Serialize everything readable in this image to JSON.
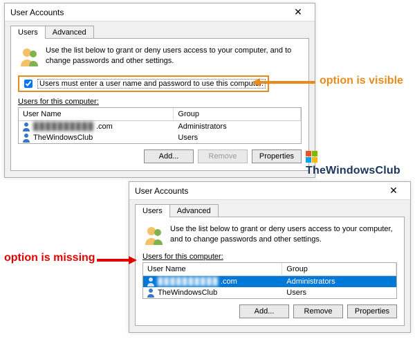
{
  "dialog1": {
    "title": "User Accounts",
    "close": "✕",
    "tabs": {
      "users": "Users",
      "advanced": "Advanced"
    },
    "intro": "Use the list below to grant or deny users access to your computer, and to change passwords and other settings.",
    "checkbox_label": "Users must enter a user name and password to use this computer.",
    "section_label": "Users for this computer:",
    "columns": {
      "name": "User Name",
      "group": "Group"
    },
    "rows": [
      {
        "name_hidden": "██████████",
        "name_suffix": ".com",
        "group": "Administrators"
      },
      {
        "name": "TheWindowsClub",
        "group": "Users"
      }
    ],
    "buttons": {
      "add": "Add...",
      "remove": "Remove",
      "props": "Properties"
    }
  },
  "dialog2": {
    "title": "User Accounts",
    "close": "✕",
    "tabs": {
      "users": "Users",
      "advanced": "Advanced"
    },
    "intro": "Use the list below to grant or deny users access to your computer, and to change passwords and other settings.",
    "section_label": "Users for this computer:",
    "columns": {
      "name": "User Name",
      "group": "Group"
    },
    "rows": [
      {
        "name_hidden": "██████████",
        "name_suffix": ".com",
        "group": "Administrators",
        "selected": true
      },
      {
        "name": "TheWindowsClub",
        "group": "Users"
      }
    ],
    "buttons": {
      "add": "Add...",
      "remove": "Remove",
      "props": "Properties"
    }
  },
  "annot": {
    "visible": "option is visible",
    "missing": "option is missing"
  },
  "watermark": "TheWindowsClub"
}
